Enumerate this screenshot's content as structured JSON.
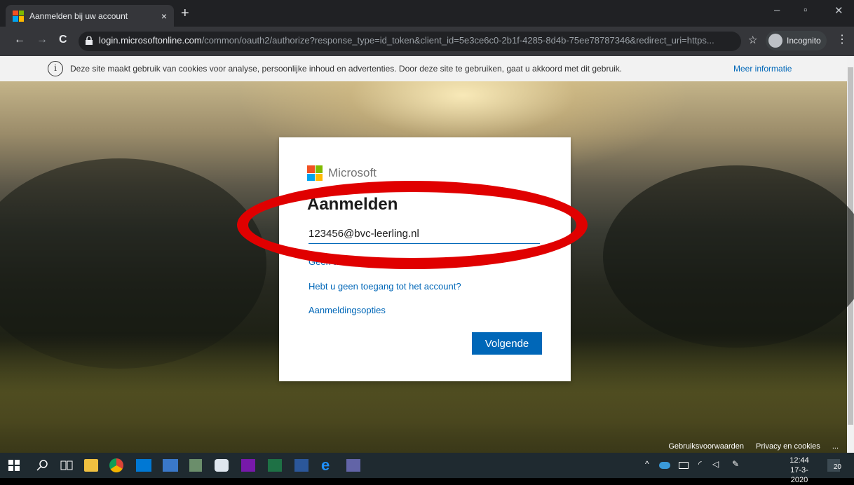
{
  "browser": {
    "tab_title": "Aanmelden bij uw account",
    "tab_close": "×",
    "new_tab": "+",
    "back": "←",
    "forward": "→",
    "reload": "C",
    "url_host": "login.microsoftonline.com",
    "url_path": "/common/oauth2/authorize?response_type=id_token&client_id=5e3ce6c0-2b1f-4285-8d4b-75ee78787346&redirect_uri=https...",
    "star": "☆",
    "incognito_label": "Incognito",
    "menu": "⋮",
    "minimize": "–",
    "restore": "▫",
    "close": "✕"
  },
  "cookie_banner": {
    "icon": "i",
    "text": "Deze site maakt gebruik van cookies voor analyse, persoonlijke inhoud en advertenties. Door deze site te gebruiken, gaat u akkoord met dit gebruik.",
    "more_link": "Meer informatie"
  },
  "login": {
    "logo_text": "Microsoft",
    "title": "Aanmelden",
    "email_value": "123456@bvc-leerling.nl",
    "no_account_link": "Geen account? Maak er een!",
    "no_access_link": "Hebt u geen toegang tot het account?",
    "options_link": "Aanmeldingsopties",
    "next_button": "Volgende"
  },
  "footer": {
    "terms": "Gebruiksvoorwaarden",
    "privacy": "Privacy en cookies",
    "more": "..."
  },
  "taskbar": {
    "time": "12:44",
    "date": "17-3-2020",
    "notification_count": "20"
  },
  "colors": {
    "accent": "#0067b8",
    "annotation": "#e00000"
  }
}
